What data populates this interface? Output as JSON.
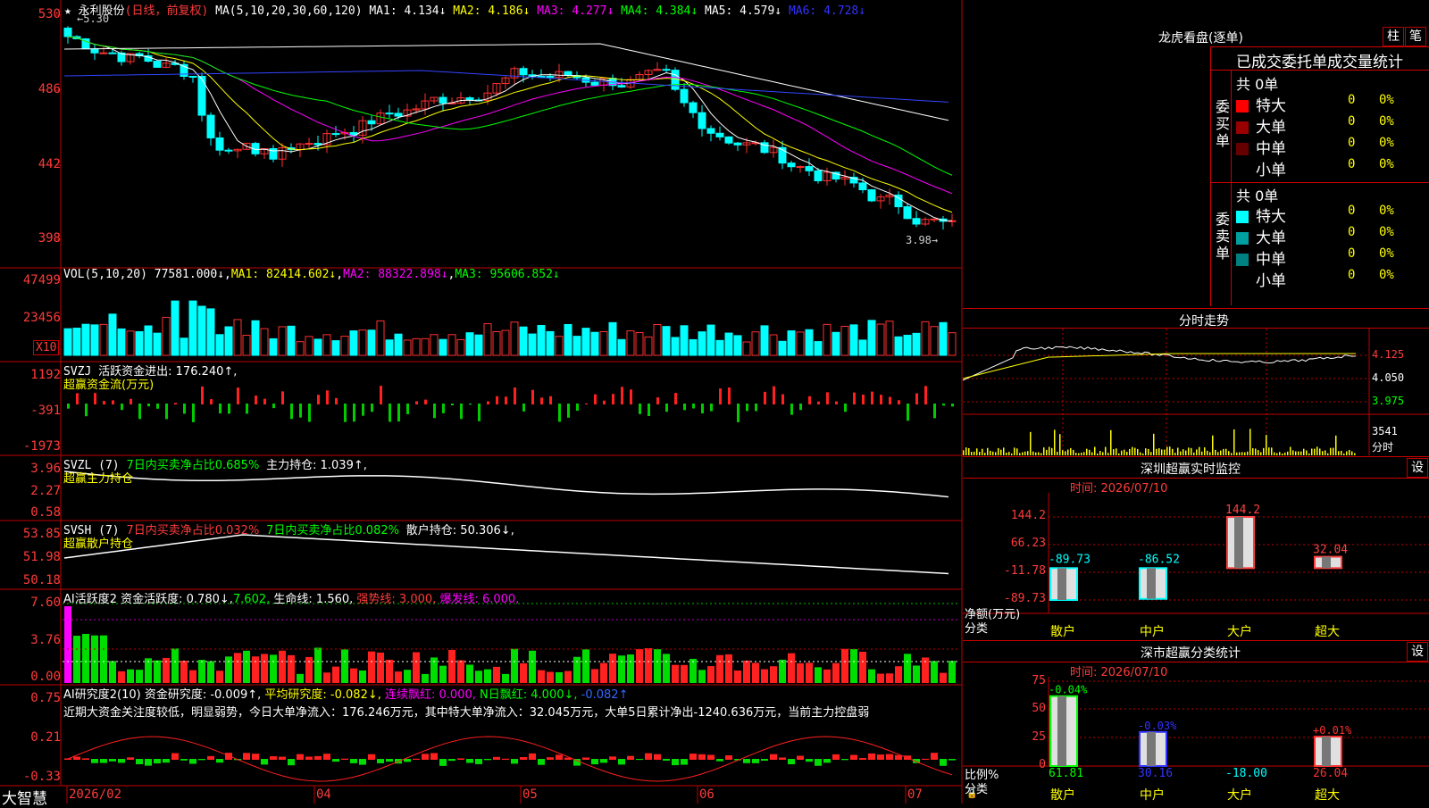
{
  "header": {
    "stock_name": "永利股份",
    "period_label": "(日线，前复权)",
    "ma_line": [
      {
        "label": "MA(5,10,20,30,60,120)",
        "value": "",
        "color": "#ffffff"
      },
      {
        "label": "MA1:",
        "value": "4.134↓",
        "color": "#ffffff"
      },
      {
        "label": "MA2:",
        "value": "4.186↓",
        "color": "#ffff00"
      },
      {
        "label": "MA3:",
        "value": "4.277↓",
        "color": "#ff00ff"
      },
      {
        "label": "MA4:",
        "value": "4.384↓",
        "color": "#00ff00"
      },
      {
        "label": "MA5:",
        "value": "4.579↓",
        "color": "#ffffff"
      },
      {
        "label": "MA6:",
        "value": "4.728↓",
        "color": "#3333ff"
      }
    ],
    "high_marker": "5.30",
    "low_marker": "3.98"
  },
  "price_axis": [
    "530",
    "486",
    "442",
    "398"
  ],
  "vol": {
    "title": "VOL(5,10,20)",
    "value": "77581.000↓",
    "ma1": "MA1: 82414.602↓",
    "ma2": "MA2: 88322.898↓",
    "ma3": "MA3: 95606.852↓",
    "axis": [
      "47499",
      "23456"
    ],
    "unit": "X10"
  },
  "svzj": {
    "title": "SVZJ",
    "line1": "活跃资金进出: 176.240↑,",
    "line2": "超赢资金流(万元)",
    "axis": [
      "1192",
      "-391",
      "-1973"
    ]
  },
  "svzl": {
    "title": "SVZL (7)",
    "ratio": "7日内买卖净占比0.685%",
    "main": "主力持仓: 1.039↑,",
    "line2": "超赢主力持仓",
    "axis": [
      "3.96",
      "2.27",
      "0.58"
    ]
  },
  "svsh": {
    "title": "SVSH (7)",
    "ratio1": "7日内买卖净占比0.032%",
    "ratio2": "7日内买卖净占比0.082%",
    "retail": "散户持仓: 50.306↓,",
    "line2": "超赢散户持仓",
    "axis": [
      "53.85",
      "51.98",
      "50.18"
    ]
  },
  "ai_active": {
    "title": "AI活跃度2",
    "fund": "资金活跃度: 0.780↓,",
    "v2": "7.602,",
    "life": "生命线: 1.560,",
    "strong": "强势线: 3.000,",
    "burst": "爆发线: 6.000,",
    "axis": [
      "7.60",
      "3.76",
      "0.00"
    ]
  },
  "ai_research": {
    "title": "AI研究度2(10)",
    "fund": "资金研究度: -0.009↑,",
    "avg": "平均研究度: -0.082↓,",
    "red": "连续飘红: 0.000,",
    "nred": "N日飘红: 4.000↓,",
    "last": "-0.082↑",
    "comment": "近期大资金关注度较低，明显弱势，今日大单净流入：176.246万元，其中特大单净流入：32.045万元，大单5日累计净出-1240.636万元，当前主力控盘弱",
    "axis": [
      "0.75",
      "0.21",
      "-0.33"
    ]
  },
  "xaxis": [
    "2026/02",
    "04",
    "05",
    "06",
    "07"
  ],
  "logo": "大智慧",
  "dragon": {
    "title": "龙虎看盘(逐单)",
    "btn1": "柱",
    "btn2": "笔",
    "subtitle": "已成交委托单成交量统计",
    "buy_label": "委买单",
    "sell_label": "委卖单",
    "buy_total": "共 0单",
    "sell_total": "共 0单",
    "buy_rows": [
      {
        "label": "特大",
        "count": "0",
        "pct": "0%",
        "color": "#ff0000"
      },
      {
        "label": "大单",
        "count": "0",
        "pct": "0%",
        "color": "#990000"
      },
      {
        "label": "中单",
        "count": "0",
        "pct": "0%",
        "color": "#660000"
      },
      {
        "label": "小单",
        "count": "0",
        "pct": "0%",
        "color": ""
      }
    ],
    "sell_rows": [
      {
        "label": "特大",
        "count": "0",
        "pct": "0%",
        "color": "#00ffff"
      },
      {
        "label": "大单",
        "count": "0",
        "pct": "0%",
        "color": "#00a0a0"
      },
      {
        "label": "中单",
        "count": "0",
        "pct": "0%",
        "color": "#008080"
      },
      {
        "label": "小单",
        "count": "0",
        "pct": "0%",
        "color": ""
      }
    ]
  },
  "intraday": {
    "title": "分时走势",
    "axis": [
      "4.125",
      "4.050",
      "3.975"
    ],
    "vol_axis": "3541",
    "vol_label": "分时"
  },
  "sz_monitor": {
    "title": "深圳超赢实时监控",
    "btn": "设",
    "time": "时间: 2026/07/10",
    "axis": [
      "144.2",
      "66.23",
      "-11.78",
      "-89.73"
    ],
    "axis_label1": "净额(万元)",
    "axis_label2": "分类",
    "categories": [
      "散户",
      "中户",
      "大户",
      "超大"
    ],
    "values": [
      "-89.73",
      "-86.52",
      "144.2",
      "32.04"
    ]
  },
  "sz_stats": {
    "title": "深市超赢分类统计",
    "btn": "设",
    "time": "时间: 2026/07/10",
    "axis": [
      "75",
      "50",
      "25",
      "0"
    ],
    "axis_label1": "比例%",
    "axis_label2": "分类",
    "categories": [
      "散户",
      "中户",
      "大户",
      "超大"
    ],
    "top_labels": [
      "-0.04%",
      "-0.03%",
      "",
      "+0.01%"
    ],
    "bottom_values": [
      "61.81",
      "30.16",
      "-18.00",
      "26.04"
    ]
  }
}
